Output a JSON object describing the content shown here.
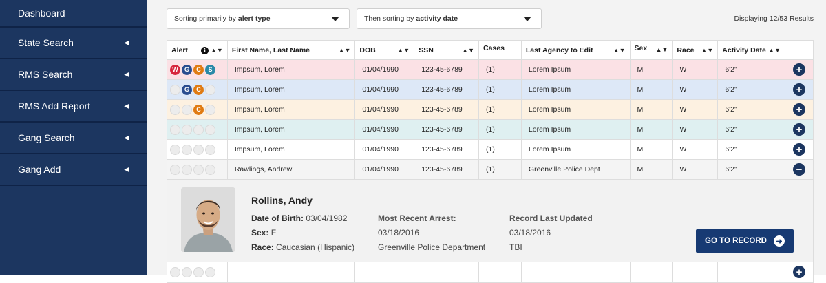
{
  "sidebar": {
    "items": [
      {
        "label": "Dashboard",
        "caret": ""
      },
      {
        "label": "State Search",
        "caret": "◀"
      },
      {
        "label": "RMS Search",
        "caret": "◀"
      },
      {
        "label": "RMS Add Report",
        "caret": "◀"
      },
      {
        "label": "Gang Search",
        "caret": "◀"
      },
      {
        "label": "Gang Add",
        "caret": "◀"
      }
    ]
  },
  "sort": {
    "primary_prefix": "Sorting primarily by",
    "primary_value": "alert type",
    "secondary_prefix": "Then sorting by",
    "secondary_value": "activity date",
    "results": "Displaying 12/53 Results"
  },
  "table": {
    "headers": {
      "alert": "Alert",
      "name": "First Name, Last Name",
      "dob": "DOB",
      "ssn": "SSN",
      "cases": "Cases",
      "agency": "Last Agency to Edit",
      "sex": "Sex",
      "race": "Race",
      "date": "Activity Date"
    },
    "rows": [
      {
        "alerts": [
          "W",
          "G",
          "C",
          "S"
        ],
        "name": "Impsum, Lorem",
        "dob": "01/04/1990",
        "ssn": "123-45-6789",
        "cases": "(1)",
        "agency": "Lorem Ipsum",
        "sex": "M",
        "race": "W",
        "date": "6'2\"",
        "bg": "#fbe1e5",
        "action": "+"
      },
      {
        "alerts": [
          "",
          "G",
          "C",
          ""
        ],
        "name": "Impsum, Lorem",
        "dob": "01/04/1990",
        "ssn": "123-45-6789",
        "cases": "(1)",
        "agency": "Lorem Ipsum",
        "sex": "M",
        "race": "W",
        "date": "6'2\"",
        "bg": "#dde8f7",
        "action": "+"
      },
      {
        "alerts": [
          "",
          "",
          "C",
          ""
        ],
        "name": "Impsum, Lorem",
        "dob": "01/04/1990",
        "ssn": "123-45-6789",
        "cases": "(1)",
        "agency": "Lorem Ipsum",
        "sex": "M",
        "race": "W",
        "date": "6'2\"",
        "bg": "#fdf1e1",
        "action": "+"
      },
      {
        "alerts": [
          "",
          "",
          "",
          ""
        ],
        "name": "Impsum, Lorem",
        "dob": "01/04/1990",
        "ssn": "123-45-6789",
        "cases": "(1)",
        "agency": "Lorem Ipsum",
        "sex": "M",
        "race": "W",
        "date": "6'2\"",
        "bg": "#dff0f1",
        "action": "+"
      },
      {
        "alerts": [
          "",
          "",
          "",
          ""
        ],
        "name": "Impsum, Lorem",
        "dob": "01/04/1990",
        "ssn": "123-45-6789",
        "cases": "(1)",
        "agency": "Lorem Ipsum",
        "sex": "M",
        "race": "W",
        "date": "6'2\"",
        "bg": "#ffffff",
        "action": "+"
      },
      {
        "alerts": [
          "",
          "",
          "",
          ""
        ],
        "name": "Rawlings, Andrew",
        "dob": "01/04/1990",
        "ssn": "123-45-6789",
        "cases": "(1)",
        "agency": "Greenville Police Dept",
        "sex": "M",
        "race": "W",
        "date": "6'2\"",
        "bg": "#f4f4f4",
        "action": "−"
      }
    ],
    "trailing_row": {
      "alerts": [
        "",
        "",
        "",
        ""
      ],
      "action": "+",
      "bg": "#ffffff"
    }
  },
  "detail": {
    "name": "Rollins, Andy",
    "dob_label": "Date of Birth:",
    "dob": "03/04/1982",
    "sex_label": "Sex:",
    "sex": "F",
    "race_label": "Race:",
    "race": "Caucasian (Hispanic)",
    "arrest_label": "Most Recent Arrest:",
    "arrest_date": "03/18/2016",
    "arrest_agency": "Greenville Police Department",
    "updated_label": "Record Last Updated",
    "updated_date": "03/18/2016",
    "updated_by": "TBI",
    "goto_label": "GO TO RECORD"
  }
}
